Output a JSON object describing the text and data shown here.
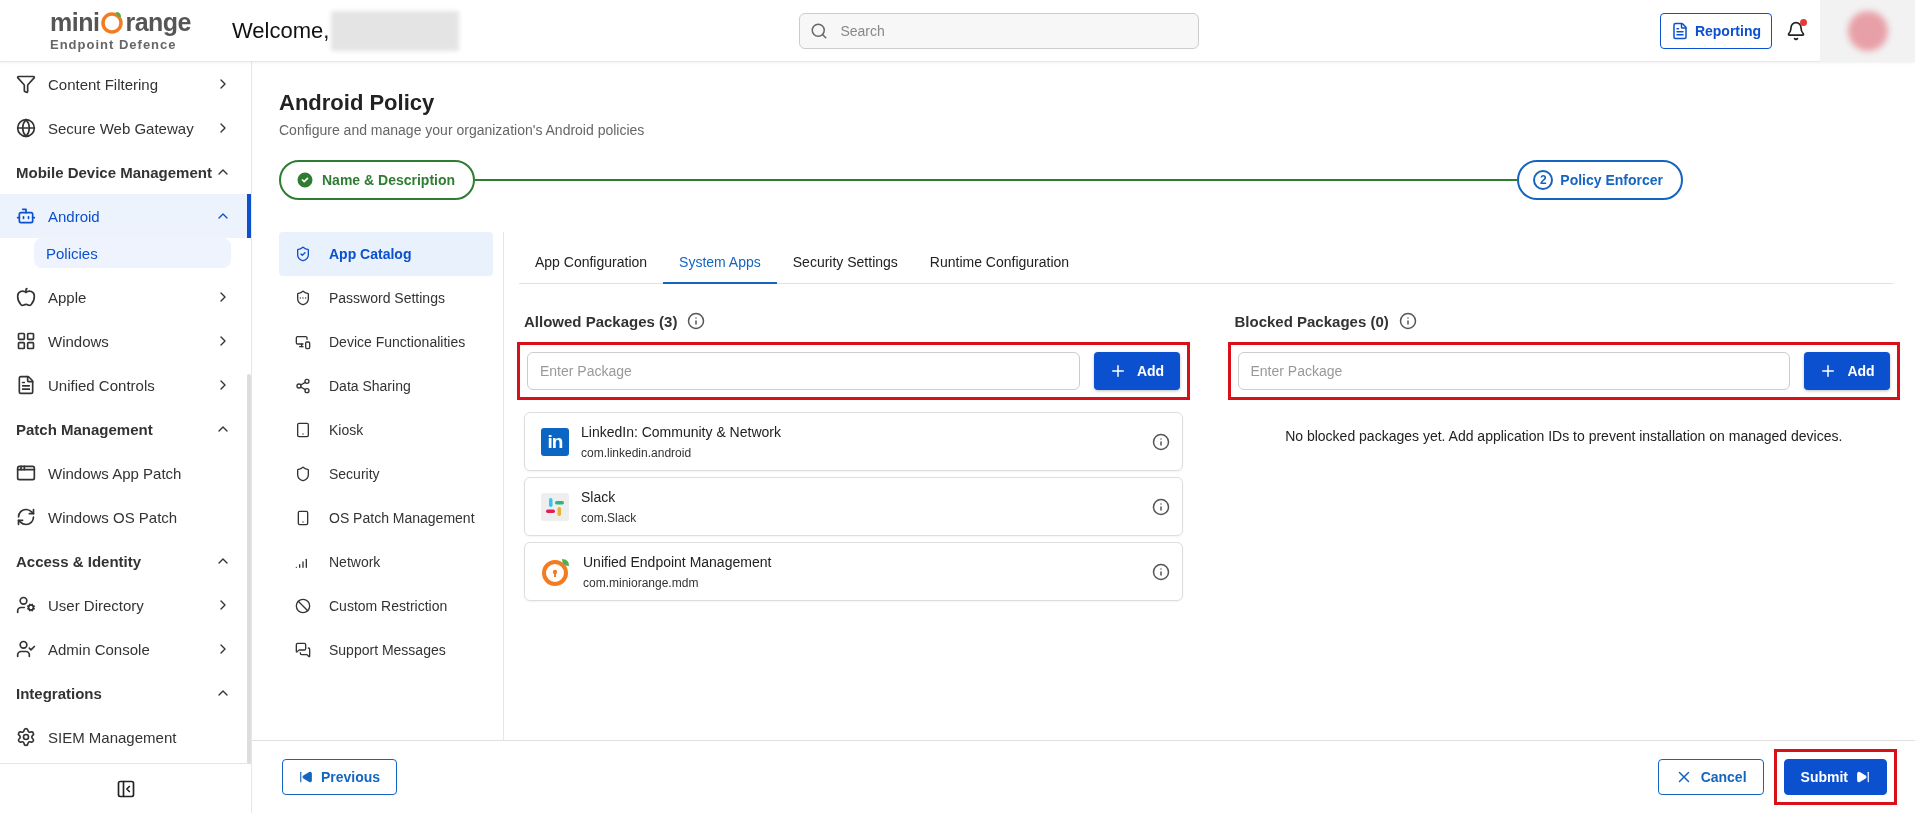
{
  "brand": {
    "name_start": "mini",
    "name_end": "range",
    "tagline": "Endpoint Defence"
  },
  "header": {
    "welcome": "Welcome,",
    "search": {
      "placeholder": "Search"
    },
    "reporting": "Reporting",
    "has_notification": true
  },
  "sidebar": {
    "groups": [
      {
        "items": [
          {
            "label": "Content Filtering",
            "selected": false,
            "expanded": false
          },
          {
            "label": "Secure Web Gateway",
            "selected": false,
            "expanded": false
          }
        ]
      },
      {
        "label": "Mobile Device Management",
        "expanded": true,
        "items": [
          {
            "label": "Android",
            "selected": true,
            "expanded": true,
            "children": [
              {
                "label": "Policies",
                "selected": true
              }
            ]
          },
          {
            "label": "Apple",
            "selected": false,
            "expanded": false
          },
          {
            "label": "Windows",
            "selected": false,
            "expanded": false
          },
          {
            "label": "Unified Controls",
            "selected": false,
            "expanded": false
          }
        ]
      },
      {
        "label": "Patch Management",
        "expanded": true,
        "items": [
          {
            "label": "Windows App Patch",
            "selected": false
          },
          {
            "label": "Windows OS Patch",
            "selected": false
          }
        ]
      },
      {
        "label": "Access & Identity",
        "expanded": true,
        "items": [
          {
            "label": "User Directory",
            "selected": false,
            "expanded": false
          },
          {
            "label": "Admin Console",
            "selected": false,
            "expanded": false
          }
        ]
      },
      {
        "label": "Integrations",
        "expanded": true,
        "items": [
          {
            "label": "SIEM Management",
            "selected": false
          }
        ]
      }
    ]
  },
  "page": {
    "title": "Android Policy",
    "subtitle": "Configure and manage your organization's Android policies"
  },
  "steps": [
    {
      "label": "Name & Description",
      "completed": true
    },
    {
      "number": "2",
      "label": "Policy Enforcer",
      "completed": false
    }
  ],
  "policy_menu": [
    {
      "label": "App Catalog",
      "selected": true
    },
    {
      "label": "Password Settings",
      "selected": false
    },
    {
      "label": "Device Functionalities",
      "selected": false
    },
    {
      "label": "Data Sharing",
      "selected": false
    },
    {
      "label": "Kiosk",
      "selected": false
    },
    {
      "label": "Security",
      "selected": false
    },
    {
      "label": "OS Patch Management",
      "selected": false
    },
    {
      "label": "Network",
      "selected": false
    },
    {
      "label": "Custom Restriction",
      "selected": false
    },
    {
      "label": "Support Messages",
      "selected": false
    }
  ],
  "tabs": [
    {
      "label": "App Configuration",
      "selected": false
    },
    {
      "label": "System Apps",
      "selected": true
    },
    {
      "label": "Security Settings",
      "selected": false
    },
    {
      "label": "Runtime Configuration",
      "selected": false
    }
  ],
  "allowed": {
    "title": "Allowed Packages (3)",
    "input": {
      "placeholder": "Enter Package"
    },
    "add": "Add",
    "highlighted": true,
    "packages": [
      {
        "kind": "linkedin",
        "logo_text": "in",
        "name": "LinkedIn: Community & Network",
        "id": "com.linkedin.android"
      },
      {
        "kind": "slack",
        "name": "Slack",
        "id": "com.Slack"
      },
      {
        "kind": "miniorange",
        "name": "Unified Endpoint Management",
        "id": "com.miniorange.mdm"
      }
    ]
  },
  "blocked": {
    "title": "Blocked Packages (0)",
    "input": {
      "placeholder": "Enter Package"
    },
    "add": "Add",
    "highlighted": true,
    "empty": "No blocked packages yet. Add application IDs to prevent installation on managed devices."
  },
  "footer": {
    "previous": "Previous",
    "cancel": "Cancel",
    "submit": "Submit",
    "submit_highlighted": true
  }
}
